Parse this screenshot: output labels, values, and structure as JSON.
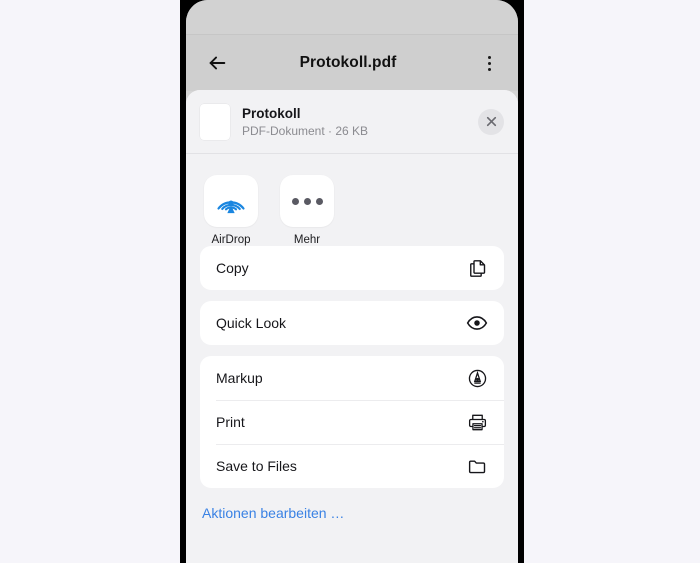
{
  "navbar": {
    "back_icon": "back-arrow-icon",
    "title": "Protokoll.pdf",
    "menu_icon": "overflow-menu-icon"
  },
  "share_sheet": {
    "file": {
      "thumbnail_icon": "pdf-thumbnail-icon",
      "name": "Protokoll",
      "meta": "PDF-Dokument · 26 KB",
      "close_icon": "close-icon"
    },
    "apps": [
      {
        "label": "AirDrop",
        "icon": "airdrop-icon"
      },
      {
        "label": "Mehr",
        "icon": "more-dots-icon"
      }
    ],
    "action_groups": [
      {
        "rows": [
          {
            "label": "Copy",
            "icon": "copy-icon"
          }
        ]
      },
      {
        "rows": [
          {
            "label": "Quick Look",
            "icon": "eye-icon"
          }
        ]
      },
      {
        "rows": [
          {
            "label": "Markup",
            "icon": "markup-pen-icon"
          },
          {
            "label": "Print",
            "icon": "printer-icon"
          },
          {
            "label": "Save to Files",
            "icon": "folder-icon"
          }
        ]
      }
    ],
    "edit_actions_label": "Aktionen bearbeiten …"
  },
  "colors": {
    "page_background": "#f6f5fa",
    "device_frame": "#000000",
    "navbar_background": "#cfcfcf",
    "sheet_background": "#f2f2f4",
    "card_background": "#ffffff",
    "link_blue": "#3a82e4",
    "airdrop_blue": "#1a86e0",
    "secondary_text": "#8b8b90"
  }
}
